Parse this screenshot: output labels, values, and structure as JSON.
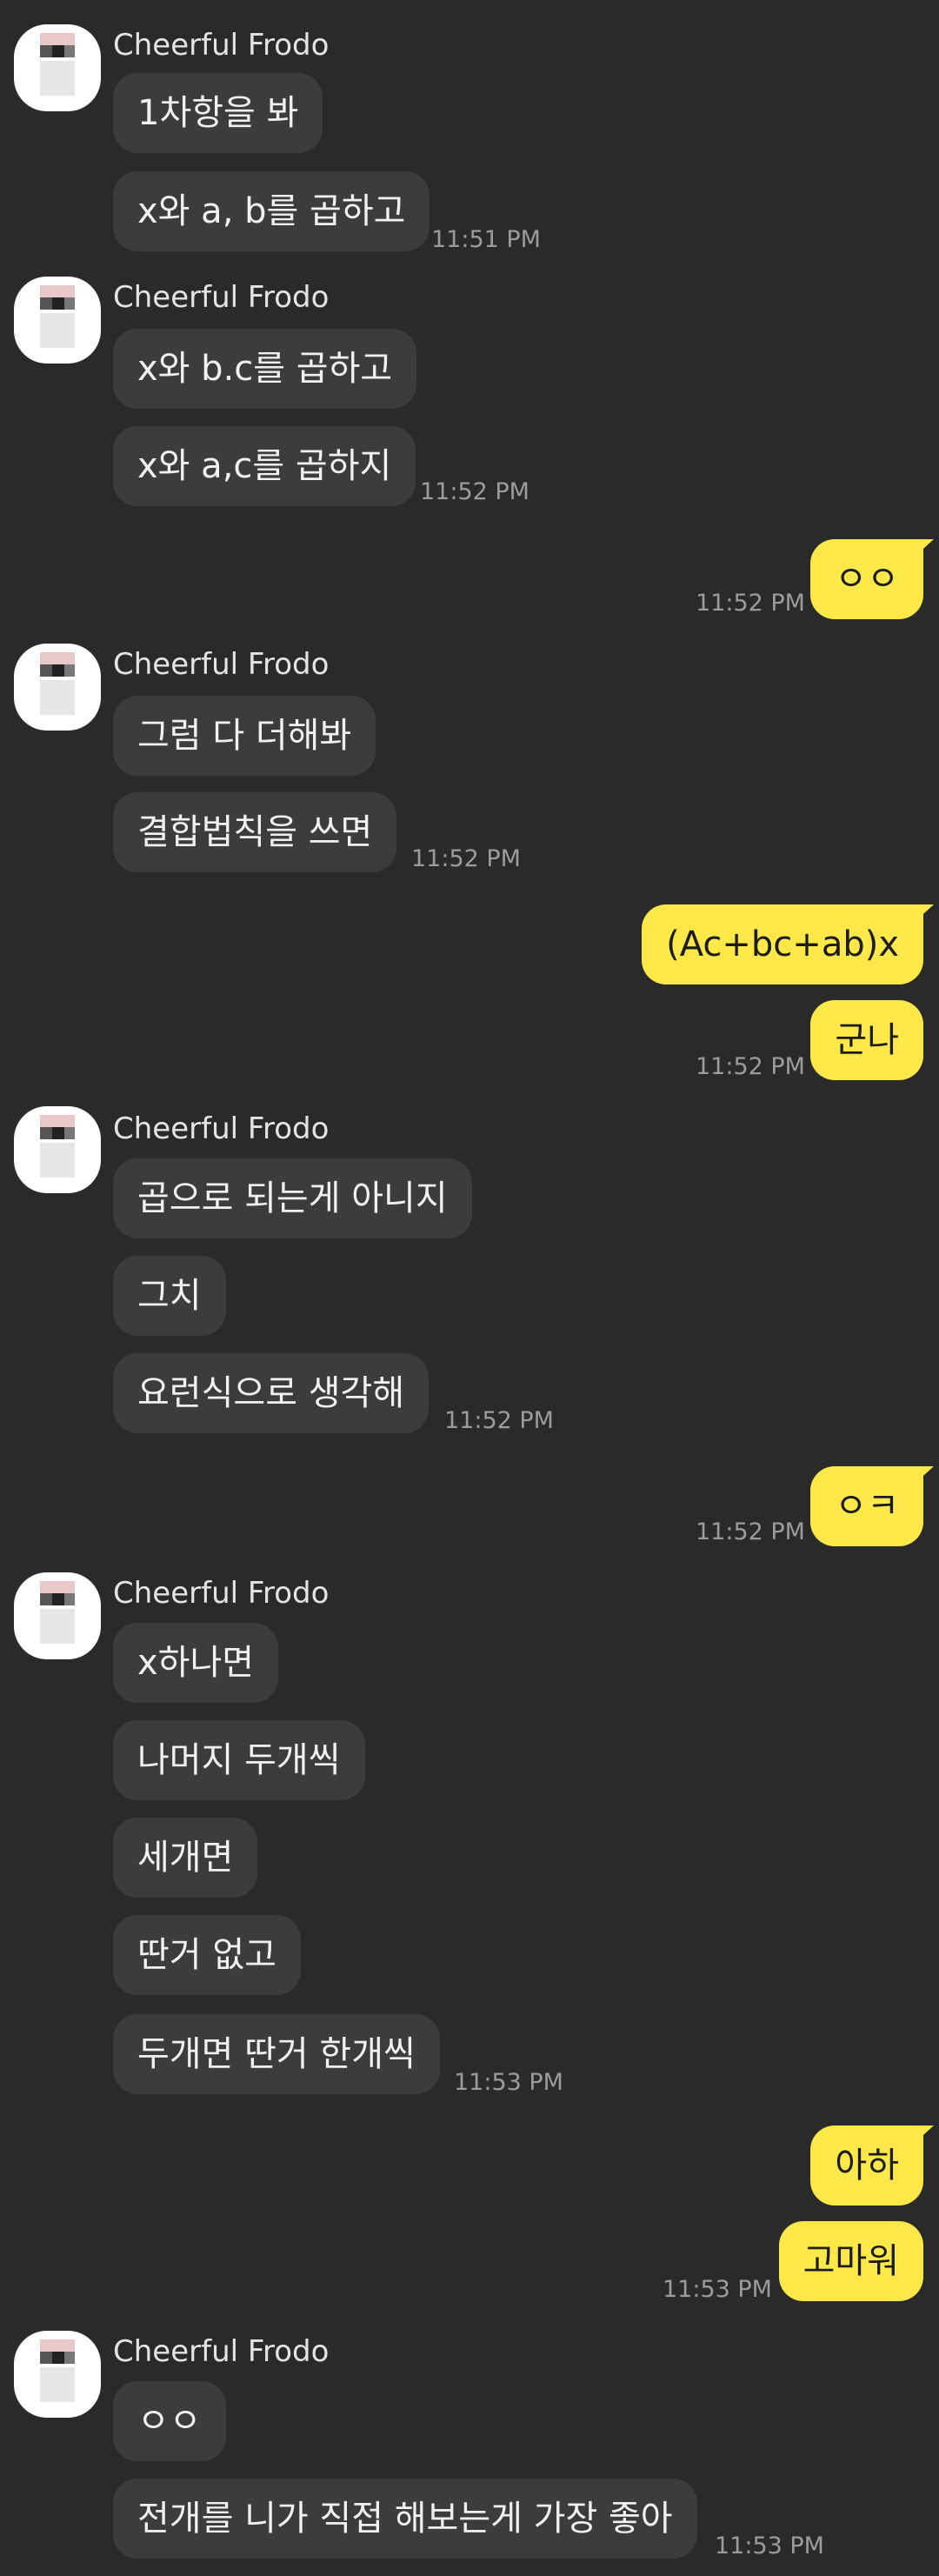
{
  "sender_name": "Cheerful Frodo",
  "messages": {
    "m1": "1차항을 봐",
    "m2": "x와 a, b를 곱하고",
    "m3": "x와 b.c를 곱하고",
    "m4": "x와 a,c를 곱하지",
    "m5": "ㅇㅇ",
    "m6": "그럼 다 더해봐",
    "m7": "결합법칙을 쓰면",
    "m8": "(Ac+bc+ab)x",
    "m9": "군나",
    "m10": "곱으로 되는게 아니지",
    "m11": "그치",
    "m12": "요런식으로 생각해",
    "m13": "ㅇㅋ",
    "m14": "x하나면",
    "m15": "나머지 두개씩",
    "m16": "세개면",
    "m17": "딴거 없고",
    "m18": "두개면 딴거 한개씩",
    "m19": "아하",
    "m20": "고마워",
    "m21": "ㅇㅇ",
    "m22": "전개를 니가 직접 해보는게 가장 좋아"
  },
  "times": {
    "t1": "11:51 PM",
    "t2": "11:52 PM",
    "t3": "11:52 PM",
    "t4": "11:52 PM",
    "t5": "11:52 PM",
    "t6": "11:52 PM",
    "t7": "11:52 PM",
    "t8": "11:53 PM",
    "t9": "11:53 PM",
    "t10": "11:53 PM"
  },
  "colors": {
    "background": "#2a2a2b",
    "incoming_bubble": "#3c3c3d",
    "outgoing_bubble": "#fde84a",
    "timestamp": "#9c9c9c"
  }
}
